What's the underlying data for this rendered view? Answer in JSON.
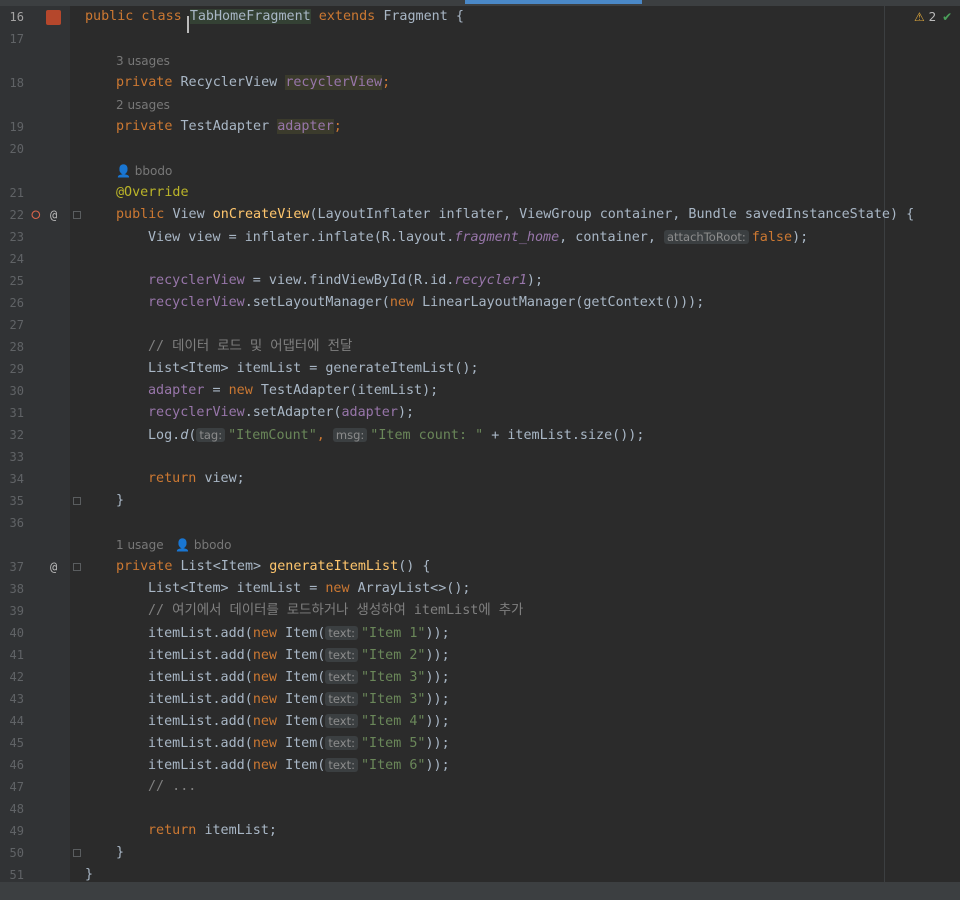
{
  "inspection": {
    "warning_count": "2"
  },
  "hints": {
    "usages_3": "3 usages",
    "usages_2": "2 usages",
    "author1": "bbodo",
    "usage_1": "1 usage",
    "author2": "bbodo"
  },
  "line_numbers": [
    "16",
    "17",
    "18",
    "19",
    "20",
    "21",
    "22",
    "23",
    "24",
    "25",
    "26",
    "27",
    "28",
    "29",
    "30",
    "31",
    "32",
    "33",
    "34",
    "35",
    "36",
    "37",
    "38",
    "39",
    "40",
    "41",
    "42",
    "43",
    "44",
    "45",
    "46",
    "47",
    "48",
    "49",
    "50",
    "51"
  ],
  "code": {
    "l16": {
      "kw": "public class ",
      "cls": "TabHomeFragment",
      "kw2": " extends ",
      "rest": "Fragment {"
    },
    "l18": {
      "kw": "private ",
      "type": "RecyclerView ",
      "fld": "recyclerView",
      "end": ";"
    },
    "l19": {
      "kw": "private ",
      "type": "TestAdapter ",
      "fld": "adapter",
      "end": ";"
    },
    "l21": {
      "ann": "@Override"
    },
    "l22": {
      "kw": "public ",
      "type": "View ",
      "fn": "onCreateView",
      "rest": "(LayoutInflater inflater, ViewGroup container, Bundle savedInstanceState) {"
    },
    "l23": {
      "a": "View view = inflater.inflate(R.layout.",
      "it": "fragment_home",
      "b": ", container, ",
      "hint": "attachToRoot:",
      "kw": "false",
      "c": ");"
    },
    "l25": {
      "fld": "recyclerView",
      "a": " = view.findViewById(R.id.",
      "it": "recycler1",
      "b": ");"
    },
    "l26": {
      "fld": "recyclerView",
      "a": ".setLayoutManager(",
      "kw": "new ",
      "b": "LinearLayoutManager(getContext()));"
    },
    "l28": {
      "cmt": "// 데이터 로드 및 어댑터에 전달"
    },
    "l29": {
      "a": "List<Item> itemList = generateItemList();"
    },
    "l30": {
      "fld": "adapter",
      "a": " = ",
      "kw": "new ",
      "b": "TestAdapter(itemList);"
    },
    "l31": {
      "fld": "recyclerView",
      "a": ".setAdapter(",
      "fld2": "adapter",
      "b": ");"
    },
    "l32": {
      "a": "Log.",
      "it": "d",
      "b": "(",
      "hint1": "tag:",
      "str1": "\"ItemCount\"",
      "c": ", ",
      "hint2": "msg:",
      "str2": "\"Item count: \"",
      "d": " + itemList.size());"
    },
    "l34": {
      "kw": "return ",
      "a": "view;"
    },
    "l35": {
      "a": "}"
    },
    "l37": {
      "kw": "private ",
      "type": "List<Item> ",
      "fn": "generateItemList",
      "rest": "() {"
    },
    "l38": {
      "a": "List<Item> itemList = ",
      "kw": "new ",
      "b": "ArrayList<>();"
    },
    "l39": {
      "cmt": "// 여기에서 데이터를 로드하거나 생성하여 itemList에 추가"
    },
    "items": [
      {
        "a": "itemList.add(",
        "kw": "new ",
        "b": "Item(",
        "hint": "text:",
        "str": "\"Item 1\"",
        "c": "));"
      },
      {
        "a": "itemList.add(",
        "kw": "new ",
        "b": "Item(",
        "hint": "text:",
        "str": "\"Item 2\"",
        "c": "));"
      },
      {
        "a": "itemList.add(",
        "kw": "new ",
        "b": "Item(",
        "hint": "text:",
        "str": "\"Item 3\"",
        "c": "));"
      },
      {
        "a": "itemList.add(",
        "kw": "new ",
        "b": "Item(",
        "hint": "text:",
        "str": "\"Item 3\"",
        "c": "));"
      },
      {
        "a": "itemList.add(",
        "kw": "new ",
        "b": "Item(",
        "hint": "text:",
        "str": "\"Item 4\"",
        "c": "));"
      },
      {
        "a": "itemList.add(",
        "kw": "new ",
        "b": "Item(",
        "hint": "text:",
        "str": "\"Item 5\"",
        "c": "));"
      },
      {
        "a": "itemList.add(",
        "kw": "new ",
        "b": "Item(",
        "hint": "text:",
        "str": "\"Item 6\"",
        "c": "));"
      }
    ],
    "l47": {
      "cmt": "// ..."
    },
    "l49": {
      "kw": "return ",
      "a": "itemList;"
    },
    "l50": {
      "a": "}"
    },
    "l51": {
      "a": "}"
    }
  },
  "colors": {
    "background": "#2b2b2b",
    "gutter": "#313335",
    "keyword": "#cc7832",
    "field": "#9876aa",
    "string": "#6a8759",
    "comment": "#808080",
    "annotation": "#bbb529",
    "method": "#ffc66d"
  },
  "icons": [
    "java-class-icon",
    "override-method-icon",
    "at-icon",
    "fold-marker-icon",
    "warning-icon",
    "check-icon"
  ]
}
